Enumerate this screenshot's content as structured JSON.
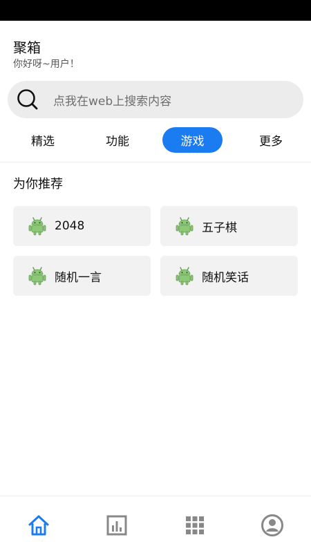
{
  "header": {
    "app_title": "聚箱",
    "greeting": "你好呀~用户！"
  },
  "search": {
    "placeholder": "点我在web上搜索内容"
  },
  "tabs": [
    {
      "label": "精选",
      "active": false
    },
    {
      "label": "功能",
      "active": false
    },
    {
      "label": "游戏",
      "active": true
    },
    {
      "label": "更多",
      "active": false
    }
  ],
  "section": {
    "title": "为你推荐"
  },
  "cards": [
    {
      "label": "2048",
      "icon": "android-icon"
    },
    {
      "label": "五子棋",
      "icon": "android-icon"
    },
    {
      "label": "随机一言",
      "icon": "android-icon"
    },
    {
      "label": "随机笑话",
      "icon": "android-icon"
    }
  ],
  "bottom_nav": {
    "items": [
      {
        "icon": "home-icon",
        "active": true
      },
      {
        "icon": "bar-chart-icon",
        "active": false
      },
      {
        "icon": "grid-icon",
        "active": false
      },
      {
        "icon": "profile-icon",
        "active": false
      }
    ]
  },
  "colors": {
    "accent": "#1a7cf0",
    "android_green": "#8cc976",
    "nav_inactive": "#888888"
  }
}
